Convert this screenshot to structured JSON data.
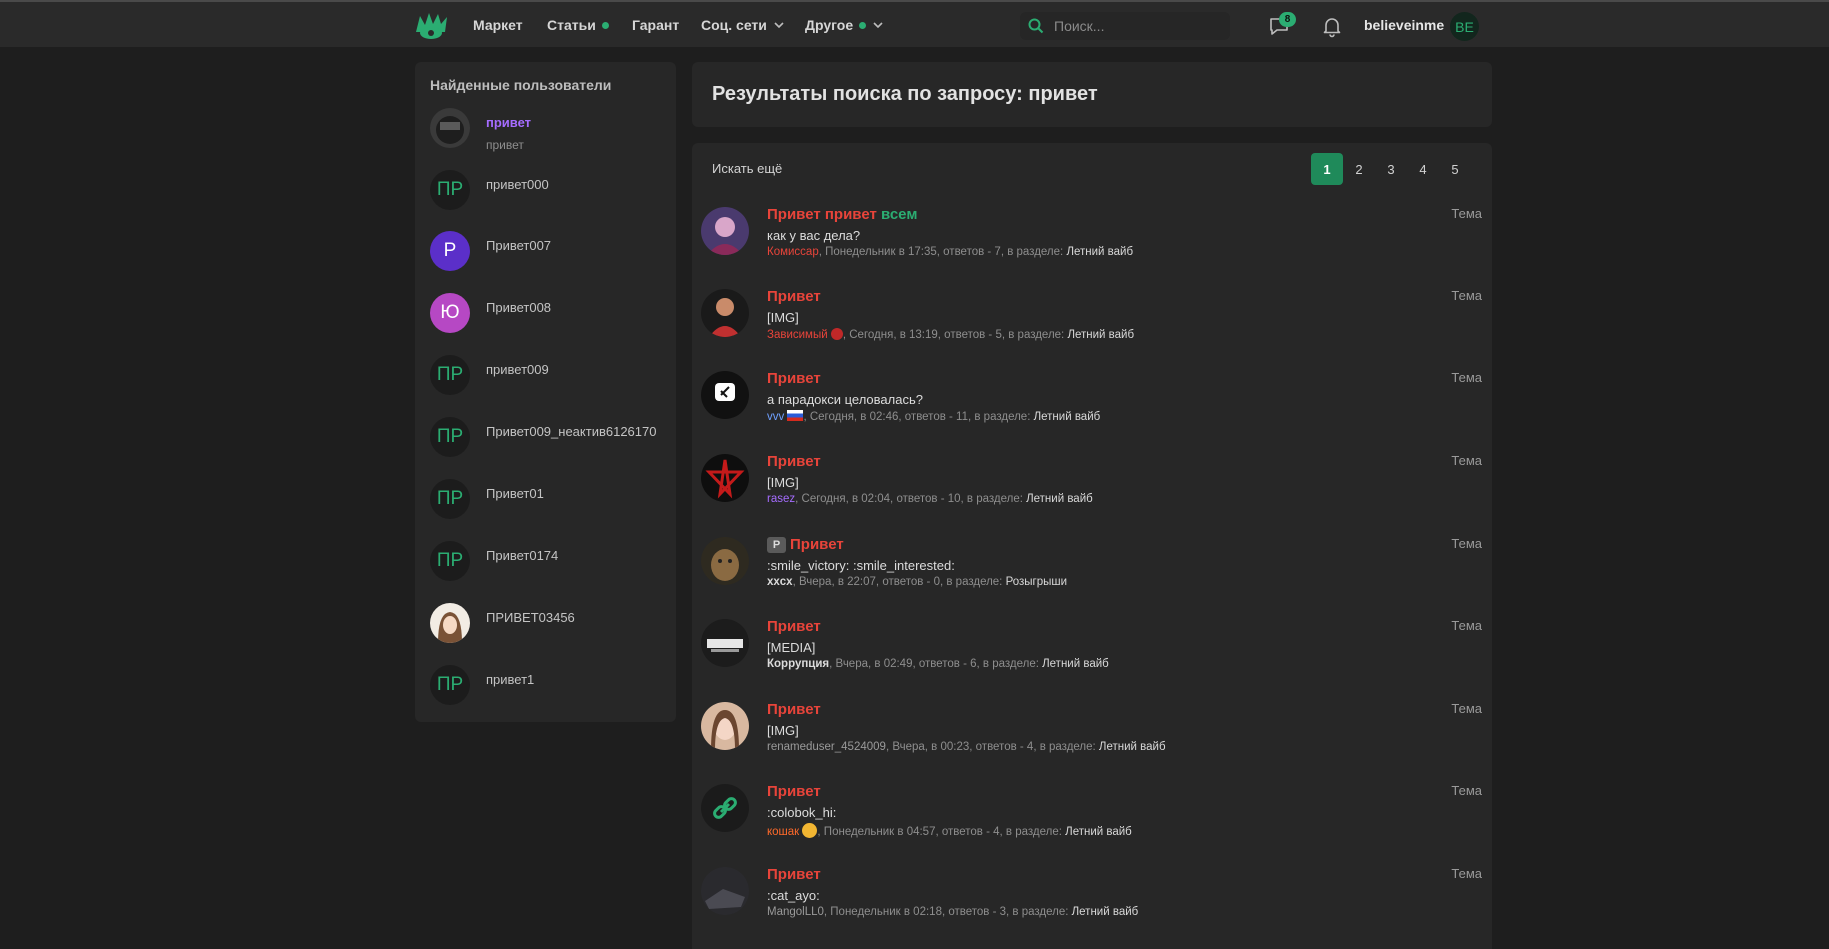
{
  "nav": {
    "items": [
      {
        "label": "Маркет"
      },
      {
        "label": "Статьи"
      },
      {
        "label": "Гарант"
      },
      {
        "label": "Соц. сети"
      },
      {
        "label": "Другое"
      }
    ],
    "search_placeholder": "Поиск...",
    "messages_count": "8",
    "username": "believeinme",
    "user_initials": "BE"
  },
  "colors": {
    "accent": "#2bad72",
    "title_red": "#e8443a",
    "background": "#1e1e1e",
    "panel": "#272727"
  },
  "sidebar": {
    "title": "Найденные пользователи",
    "users": [
      {
        "name": "привет",
        "sub": "привет",
        "avatar": "image"
      },
      {
        "name": "привет000",
        "avatar": "ПР"
      },
      {
        "name": "Привет007",
        "avatar": "Р"
      },
      {
        "name": "Привет008",
        "avatar": "Ю"
      },
      {
        "name": "привет009",
        "avatar": "ПР"
      },
      {
        "name": "Привет009_неактив6126170",
        "avatar": "ПР"
      },
      {
        "name": "Привет01",
        "avatar": "ПР"
      },
      {
        "name": "Привет0174",
        "avatar": "ПР"
      },
      {
        "name": "ПРИВЕТ03456",
        "avatar": "image"
      },
      {
        "name": "привет1",
        "avatar": "ПР"
      }
    ]
  },
  "main": {
    "heading": "Результаты поиска по запросу: привет",
    "search_more": "Искать ещё",
    "pages": [
      "1",
      "2",
      "3",
      "4",
      "5"
    ],
    "active_page": "1",
    "results": [
      {
        "title": "Привет привет",
        "title_extra": "всем",
        "snippet": "как у вас дела?",
        "author": "Комиссар",
        "meta": ", Понедельник в 17:35, ответов - 7, в разделе: ",
        "section": "Летний вайб",
        "kind": "Тема"
      },
      {
        "title": "Привет",
        "snippet": "[IMG]",
        "author": "Зависимый",
        "meta": ", Сегодня, в 13:19, ответов - 5, в разделе: ",
        "section": "Летний вайб",
        "kind": "Тема"
      },
      {
        "title": "Привет",
        "snippet": "а парадокси целовалась?",
        "author": "vvv",
        "meta": ", Сегодня, в 02:46, ответов - 11, в разделе: ",
        "section": "Летний вайб",
        "kind": "Тема"
      },
      {
        "title": "Привет",
        "snippet": "[IMG]",
        "author": "rasez",
        "meta": ", Сегодня, в 02:04, ответов - 10, в разделе: ",
        "section": "Летний вайб",
        "kind": "Тема"
      },
      {
        "prefix": "P",
        "title": "Привет",
        "snippet": ":smile_victory: :smile_interested:",
        "author": "xxcx",
        "meta": ", Вчера, в 22:07, ответов - 0, в разделе: ",
        "section": "Розыгрыши",
        "kind": "Тема"
      },
      {
        "title": "Привет",
        "snippet": "[MEDIA]",
        "author": "Коррупция",
        "meta": ", Вчера, в 02:49, ответов - 6, в разделе: ",
        "section": "Летний вайб",
        "kind": "Тема"
      },
      {
        "title": "Привет",
        "snippet": "[IMG]",
        "author": "renameduser_4524009",
        "meta": ", Вчера, в 00:23, ответов - 4, в разделе: ",
        "section": "Летний вайб",
        "kind": "Тема"
      },
      {
        "title": "Привет",
        "snippet": ":colobok_hi:",
        "author": "кошак",
        "meta": ", Понедельник в 04:57, ответов - 4, в разделе: ",
        "section": "Летний вайб",
        "kind": "Тема"
      },
      {
        "title": "Привет",
        "snippet": ":cat_ayo:",
        "author": "MangolLL0",
        "meta": ", Понедельник в 02:18, ответов - 3, в разделе: ",
        "section": "Летний вайб",
        "kind": "Тема"
      }
    ]
  }
}
